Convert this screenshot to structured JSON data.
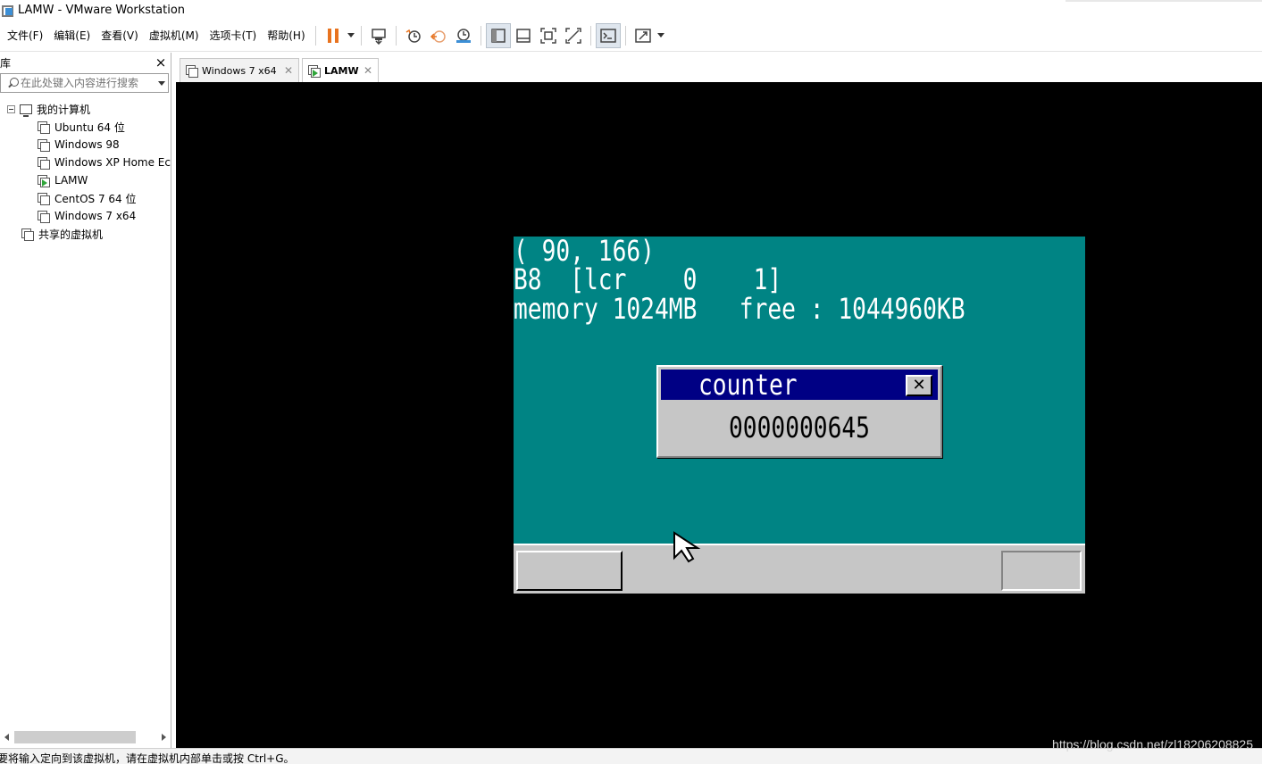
{
  "window": {
    "title": "LAMW - VMware Workstation"
  },
  "menubar": {
    "items": [
      {
        "label": "文件(F)"
      },
      {
        "label": "编辑(E)"
      },
      {
        "label": "查看(V)"
      },
      {
        "label": "虚拟机(M)"
      },
      {
        "label": "选项卡(T)"
      },
      {
        "label": "帮助(H)"
      }
    ]
  },
  "toolbar": {
    "icons": [
      "pause-icon",
      "send-ctrl-alt-del-icon",
      "snapshot-icon",
      "revert-snapshot-icon",
      "snapshot-manager-icon",
      "show-library-icon",
      "thumbnail-bar-icon",
      "full-screen-icon",
      "unity-icon",
      "console-icon",
      "stretch-icon"
    ],
    "accent_color": "#e8731f"
  },
  "library": {
    "title": "库",
    "search_placeholder": "在此处键入内容进行搜索",
    "root": "我的计算机",
    "vms": [
      {
        "label": "Ubuntu 64 位",
        "running": false
      },
      {
        "label": "Windows 98",
        "running": false
      },
      {
        "label": "Windows XP Home Ec",
        "running": false
      },
      {
        "label": "LAMW",
        "running": true
      },
      {
        "label": "CentOS 7 64 位",
        "running": false
      },
      {
        "label": "Windows 7 x64",
        "running": false
      }
    ],
    "shared": "共享的虚拟机"
  },
  "tabs": [
    {
      "label": "Windows 7 x64",
      "active": false
    },
    {
      "label": "LAMW",
      "active": true
    }
  ],
  "guest": {
    "line1": "( 90, 166)",
    "line2": "B8  [lcr    0    1]",
    "line3": "memory 1024MB   free : 1044960KB",
    "window_title": "counter",
    "counter_value": "0000000645",
    "colors": {
      "desktop": "#008484",
      "title_bar": "#000084",
      "gray": "#c6c6c6"
    }
  },
  "statusbar": {
    "message": "要将输入定向到该虚拟机，请在虚拟机内部单击或按 Ctrl+G。",
    "watermark": "https://blog.csdn.net/zl18206208825"
  }
}
